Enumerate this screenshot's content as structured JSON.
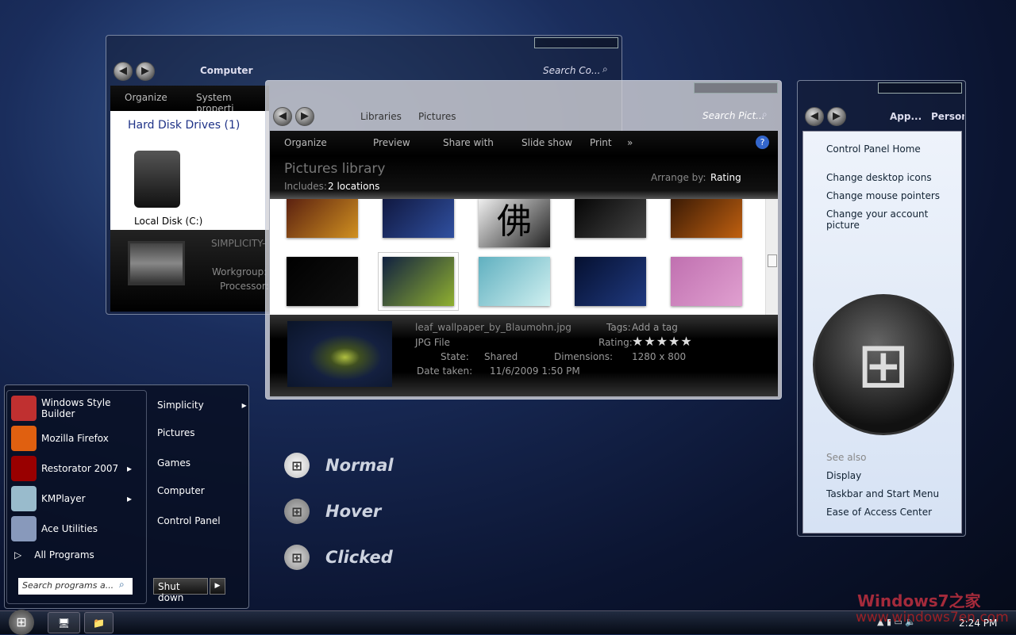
{
  "computer_window": {
    "breadcrumb": "Computer",
    "search_placeholder": "Search Co...",
    "toolbar": {
      "organize": "Organize",
      "system_properties": "System properti"
    },
    "group_header": "Hard Disk Drives (1)",
    "drive_label": "Local Disk (C:)",
    "details": {
      "name": "SIMPLICITY-",
      "workgroup_label": "Workgroup:",
      "processor_label": "Processor:"
    }
  },
  "pictures_window": {
    "breadcrumb": [
      "Libraries",
      "Pictures"
    ],
    "search_placeholder": "Search Pict...",
    "toolbar": {
      "organize": "Organize",
      "preview": "Preview",
      "share_with": "Share with",
      "slide_show": "Slide show",
      "print": "Print",
      "more": "»"
    },
    "title": "Pictures library",
    "includes_label": "Includes:",
    "includes_value": "2 locations",
    "arrange_label": "Arrange by:",
    "arrange_value": "Rating",
    "thumbnails": [
      {
        "colors": [
          "#5a2010",
          "#d09020"
        ]
      },
      {
        "colors": [
          "#101840",
          "#3050a0"
        ]
      },
      {
        "colors": [
          "#f0f0f0",
          "#222"
        ],
        "text": "佛"
      },
      {
        "colors": [
          "#050505",
          "#444"
        ]
      },
      {
        "colors": [
          "#3a1a05",
          "#c06010"
        ]
      },
      {
        "colors": [
          "#000",
          "#111"
        ]
      },
      {
        "colors": [
          "#102040",
          "#90b030"
        ]
      },
      {
        "colors": [
          "#60b0c0",
          "#d0f0f0"
        ]
      },
      {
        "colors": [
          "#051030",
          "#203a80"
        ]
      },
      {
        "colors": [
          "#c070b0",
          "#e0a0d0"
        ]
      }
    ],
    "selected_file": {
      "name": "leaf_wallpaper_by_Blaumohn.jpg",
      "type": "JPG File",
      "state_label": "State:",
      "state_value": "Shared",
      "date_label": "Date taken:",
      "date_value": "11/6/2009 1:50 PM",
      "tags_label": "Tags:",
      "tags_value": "Add a tag",
      "rating_label": "Rating:",
      "rating": 5,
      "rating_stars": "★★★★★",
      "dimensions_label": "Dimensions:",
      "dimensions_value": "1280 x 800"
    }
  },
  "control_panel": {
    "breadcrumb": [
      "App...",
      "Person"
    ],
    "links": [
      "Control Panel Home",
      "Change desktop icons",
      "Change mouse pointers",
      "Change your account picture"
    ],
    "see_also_label": "See also",
    "see_also": [
      "Display",
      "Taskbar and Start Menu",
      "Ease of Access Center"
    ]
  },
  "start_menu": {
    "programs": [
      {
        "label": "Windows Style Builder",
        "arrow": false,
        "color": "#c03030"
      },
      {
        "label": "Mozilla Firefox",
        "arrow": false,
        "color": "#e06010"
      },
      {
        "label": "Restorator 2007",
        "arrow": true,
        "color": "#900"
      },
      {
        "label": "KMPlayer",
        "arrow": true,
        "color": "#9bc"
      },
      {
        "label": "Ace Utilities",
        "arrow": false,
        "color": "#89b"
      }
    ],
    "all_programs": "All Programs",
    "search_placeholder": "Search programs a...",
    "right_items": [
      {
        "label": "Simplicity",
        "arrow": true
      },
      {
        "label": "Pictures"
      },
      {
        "label": "Games"
      },
      {
        "label": "Computer"
      },
      {
        "label": "Control Panel"
      }
    ],
    "shutdown": "Shut down"
  },
  "button_states": [
    "Normal",
    "Hover",
    "Clicked"
  ],
  "watermark": {
    "line1": "Windows7之家",
    "line2": "www.windows7en.com"
  },
  "taskbar": {
    "clock": "2:24 PM"
  }
}
